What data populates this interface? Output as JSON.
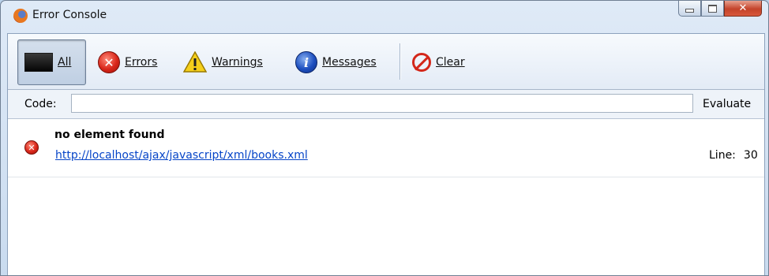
{
  "window": {
    "title": "Error Console",
    "controls": [
      "minimize",
      "maximize",
      "close"
    ]
  },
  "toolbar": {
    "buttons": [
      {
        "label": "All",
        "icon": "all-icon",
        "active": true
      },
      {
        "label": "Errors",
        "icon": "error-icon"
      },
      {
        "label": "Warnings",
        "icon": "warning-icon"
      },
      {
        "label": "Messages",
        "icon": "info-icon"
      },
      {
        "label": "Clear",
        "icon": "clear-icon"
      }
    ]
  },
  "codebar": {
    "label": "Code:",
    "value": "",
    "evaluate_label": "Evaluate"
  },
  "entries": [
    {
      "type": "error",
      "message": "no element found",
      "source": "http://localhost/ajax/javascript/xml/books.xml",
      "line_label": "Line:",
      "line": "30"
    }
  ],
  "colors": {
    "error_red": "#d9261a",
    "link_blue": "#0645c8",
    "info_blue": "#1d4fbf",
    "warning_yellow": "#f2c200"
  }
}
